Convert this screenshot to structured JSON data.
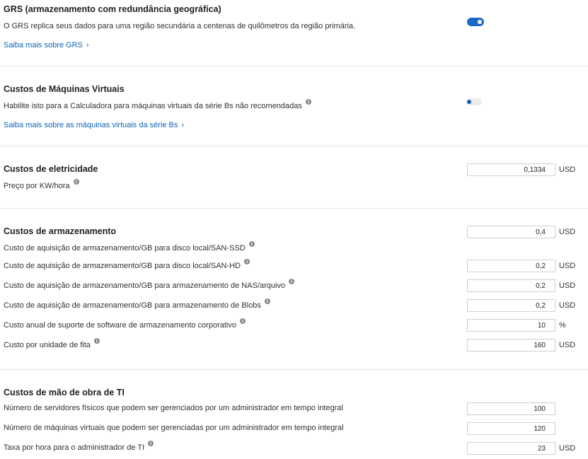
{
  "grs": {
    "title": "GRS (armazenamento com redundância geográfica)",
    "description": "O GRS replica seus dados para uma região secundária a centenas de quilômetros da região primária.",
    "link": "Saiba mais sobre GRS",
    "toggle_on": true
  },
  "vm": {
    "title": "Custos de Máquinas Virtuais",
    "description": "Habilite isto para a Calculadora para máquinas virtuais da série Bs não recomendadas",
    "link": "Saiba mais sobre as máquinas virtuais da série Bs",
    "toggle_on": false
  },
  "electricity": {
    "title": "Custos de eletricidade",
    "price_label": "Preço por KW/hora",
    "price_value": "0,1334",
    "unit": "USD"
  },
  "storage": {
    "title": "Custos de armazenamento",
    "rows": [
      {
        "label": "Custo de aquisição de armazenamento/GB para disco local/SAN-SSD",
        "value": "0,4",
        "unit": "USD"
      },
      {
        "label": "Custo de aquisição de armazenamento/GB para disco local/SAN-HD",
        "value": "0,2",
        "unit": "USD"
      },
      {
        "label": "Custo de aquisição de armazenamento/GB para armazenamento de NAS/arquivo",
        "value": "0,2",
        "unit": "USD"
      },
      {
        "label": "Custo de aquisição de armazenamento/GB para armazenamento de Blobs",
        "value": "0,2",
        "unit": "USD"
      },
      {
        "label": "Custo anual de suporte de software de armazenamento corporativo",
        "value": "10",
        "unit": "%"
      },
      {
        "label": "Custo por unidade de fita",
        "value": "160",
        "unit": "USD"
      }
    ]
  },
  "labor": {
    "title": "Custos de mão de obra de TI",
    "rows": [
      {
        "label": "Número de servidores físicos que podem ser gerenciados por um administrador em tempo integral",
        "value": "100",
        "unit": ""
      },
      {
        "label": "Número de máquinas virtuais que podem ser gerenciadas por um administrador em tempo integral",
        "value": "120",
        "unit": ""
      },
      {
        "label": "Taxa por hora para o administrador de TI",
        "value": "23",
        "unit": "USD"
      }
    ]
  },
  "icons": {
    "info": "i",
    "chevron": "›"
  }
}
